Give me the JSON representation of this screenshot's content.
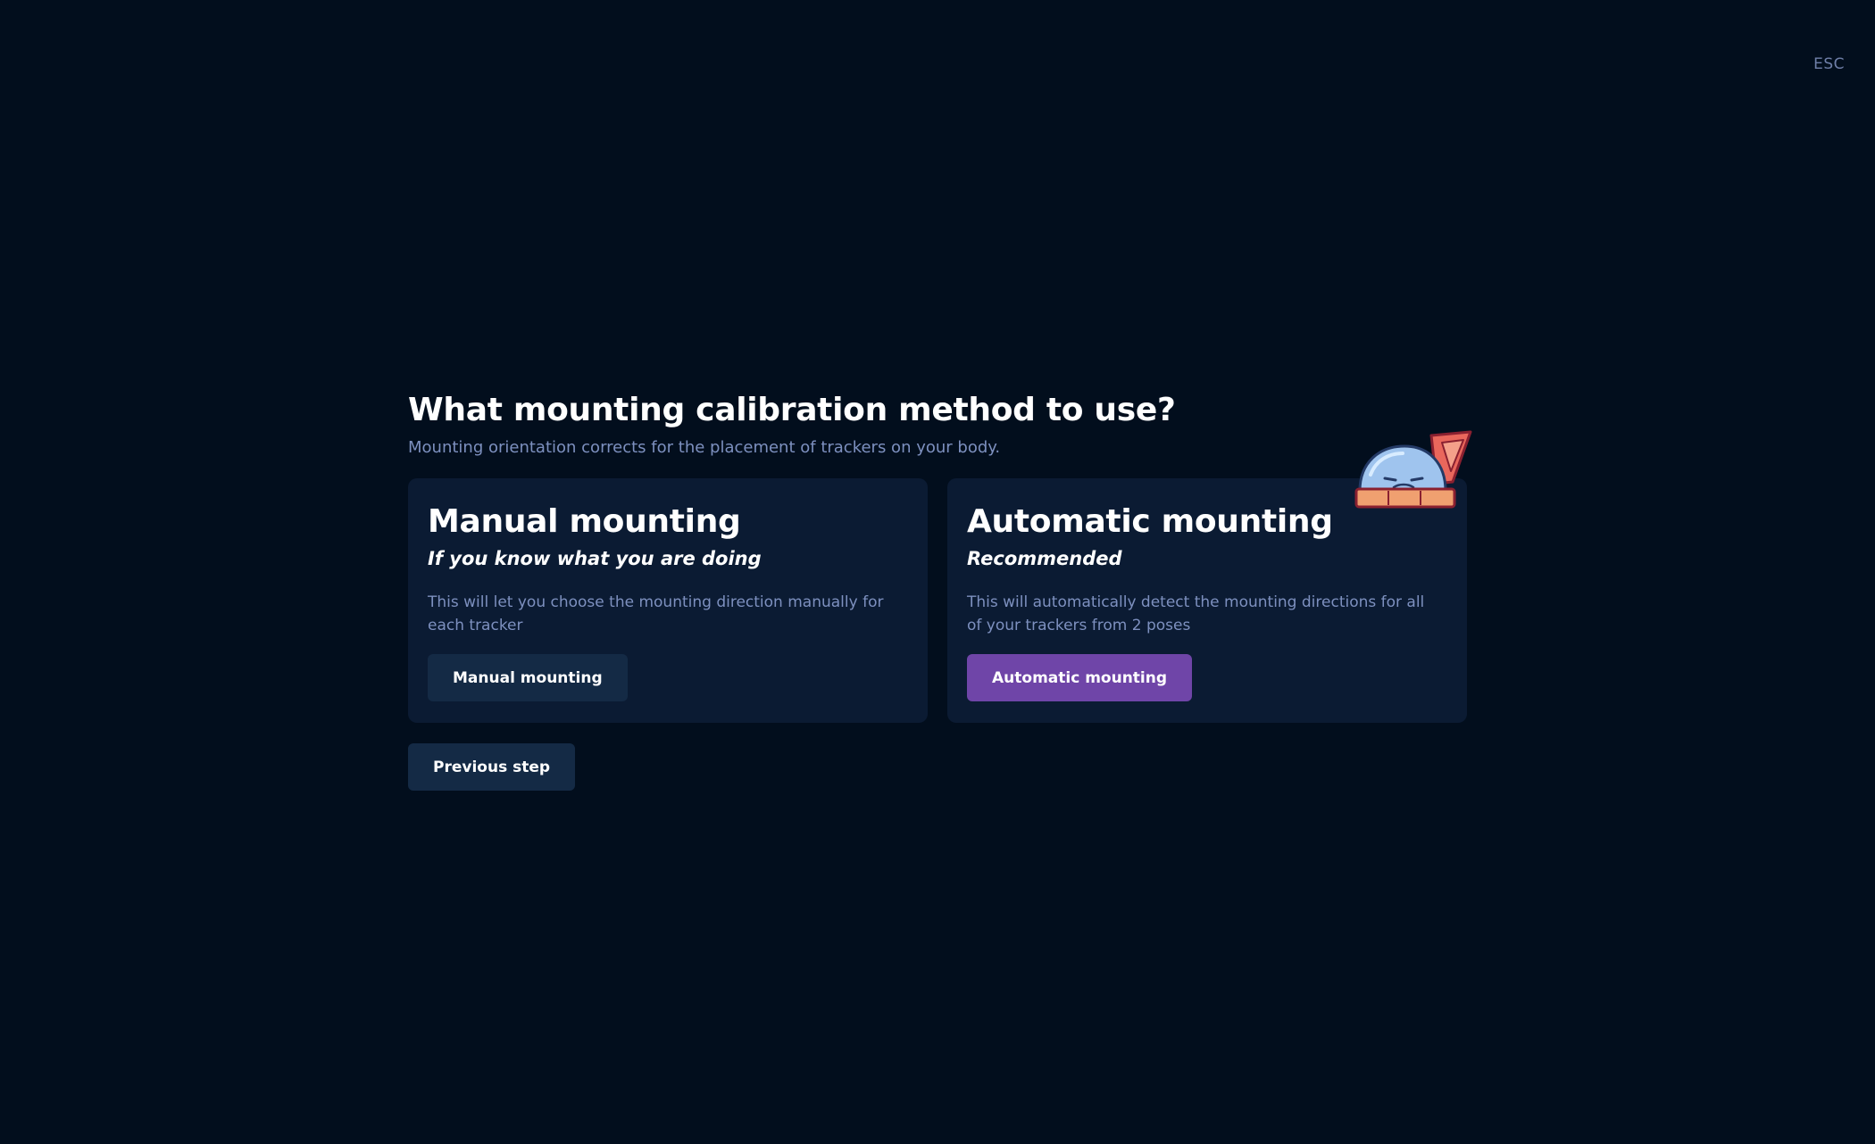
{
  "esc_label": "ESC",
  "title": "What mounting calibration method to use?",
  "subtitle": "Mounting orientation corrects for the placement of trackers on your body.",
  "manual": {
    "title": "Manual mounting",
    "subtitle": "If you know what you are doing",
    "description": "This will let you choose the mounting direction manually for each tracker",
    "button_label": "Manual mounting"
  },
  "automatic": {
    "title": "Automatic mounting",
    "subtitle": "Recommended",
    "description": "This will automatically detect the mounting directions for all of your trackers from 2 poses",
    "button_label": "Automatic mounting"
  },
  "previous_label": "Previous step",
  "colors": {
    "background": "#020e1d",
    "card": "#0b1b33",
    "muted_text": "#7d90bf",
    "dark_button": "#142a45",
    "accent_button": "#6f45a8"
  },
  "icons": {
    "mascot": "slime-mascot-with-protractor-icon"
  }
}
